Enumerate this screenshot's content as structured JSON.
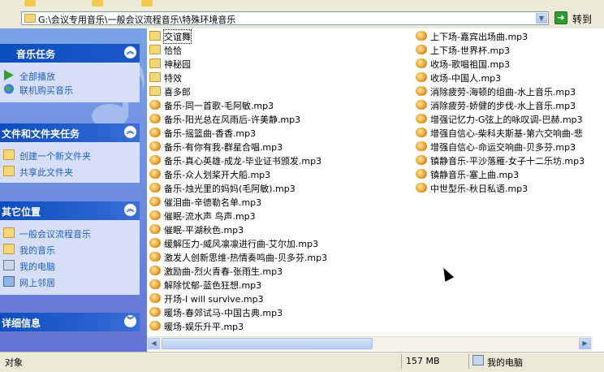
{
  "address": {
    "path": "G:\\会议专用音乐\\一般会议流程音乐\\特殊环境音乐",
    "go_label": "转到"
  },
  "tasks": {
    "music_tasks": {
      "title": "音乐任务",
      "items": [
        {
          "label": "全部播放",
          "icon": "play-icon"
        },
        {
          "label": "联机购买音乐",
          "icon": "globe-icon"
        }
      ]
    },
    "file_folder_tasks": {
      "title": "文件和文件夹任务",
      "items": [
        {
          "label": "创建一个新文件夹",
          "icon": "new-folder-icon"
        },
        {
          "label": "共享此文件夹",
          "icon": "share-folder-icon"
        }
      ]
    },
    "other_places": {
      "title": "其它位置",
      "items": [
        {
          "label": "一般会议流程音乐",
          "icon": "folder-icon"
        },
        {
          "label": "我的音乐",
          "icon": "music-folder-icon"
        },
        {
          "label": "我的电脑",
          "icon": "computer-icon"
        },
        {
          "label": "网上邻居",
          "icon": "network-icon"
        }
      ]
    },
    "details": {
      "title": "详细信息"
    }
  },
  "files_col1": [
    {
      "name": "交谊舞",
      "type": "folder"
    },
    {
      "name": "恰恰",
      "type": "folder"
    },
    {
      "name": "神秘园",
      "type": "folder"
    },
    {
      "name": "特效",
      "type": "folder"
    },
    {
      "name": "喜多郎",
      "type": "folder"
    },
    {
      "name": "备乐-同一首歌-毛阿敏.mp3",
      "type": "mp3"
    },
    {
      "name": "备乐-阳光总在风雨后-许美静.mp3",
      "type": "mp3"
    },
    {
      "name": "备乐-摇篮曲-香香.mp3",
      "type": "mp3"
    },
    {
      "name": "备乐-有你有我-群星合唱.mp3",
      "type": "mp3"
    },
    {
      "name": "备乐-真心英雄-成龙-毕业证书颁发.mp3",
      "type": "mp3"
    },
    {
      "name": "备乐-众人划桨开大船.mp3",
      "type": "mp3"
    },
    {
      "name": "备乐-烛光里的妈妈(毛阿敏).mp3",
      "type": "mp3"
    },
    {
      "name": "催泪曲-辛德勒名单.mp3",
      "type": "mp3"
    },
    {
      "name": "催眠-流水声 鸟声.mp3",
      "type": "mp3"
    },
    {
      "name": "催眠-平湖秋色.mp3",
      "type": "mp3"
    },
    {
      "name": "缓解压力-威风凛凛进行曲-艾尔加.mp3",
      "type": "mp3"
    },
    {
      "name": "激发人创新思维-热情奏鸣曲-贝多芬.mp3",
      "type": "mp3"
    },
    {
      "name": "激励曲-烈火青春-张雨生.mp3",
      "type": "mp3"
    },
    {
      "name": "解除忧郁-蓝色狂想.mp3",
      "type": "mp3"
    },
    {
      "name": "开场-I will survive.mp3",
      "type": "mp3"
    },
    {
      "name": "暖场-春郊试马-中国古典.mp3",
      "type": "mp3"
    },
    {
      "name": "暖场-娱乐升平.mp3",
      "type": "mp3"
    }
  ],
  "files_col2": [
    {
      "name": "上下场-嘉宾出场曲.mp3",
      "type": "mp3"
    },
    {
      "name": "上下场-世界杯.mp3",
      "type": "mp3"
    },
    {
      "name": "收场-歌唱祖国.mp3",
      "type": "mp3"
    },
    {
      "name": "收场-中国人.mp3",
      "type": "mp3"
    },
    {
      "name": "消除疲劳-海顿的组曲-水上音乐.mp3",
      "type": "mp3"
    },
    {
      "name": "消除疲劳-娇健的步伐-水上音乐.mp3",
      "type": "mp3"
    },
    {
      "name": "增强记忆力-G弦上的咏叹调-巴赫.mp3",
      "type": "mp3"
    },
    {
      "name": "增强自信心-柴科夫斯基-第六交响曲-悲",
      "type": "mp3"
    },
    {
      "name": "增强自信心-命运交响曲-贝多芬.mp3",
      "type": "mp3"
    },
    {
      "name": "镇静音乐-平沙落雁-女子十二乐坊.mp3",
      "type": "mp3"
    },
    {
      "name": "镇静音乐-塞上曲.mp3",
      "type": "mp3"
    },
    {
      "name": "中世型乐-秋日私语.mp3",
      "type": "mp3"
    }
  ],
  "status": {
    "objects": "对象",
    "size": "157 MB",
    "location": "我的电脑"
  },
  "colors": {
    "taskpane": "#6b8fe0",
    "task_header": "#0c4ebf",
    "link": "#215dc6",
    "folder": "#f6d778"
  }
}
